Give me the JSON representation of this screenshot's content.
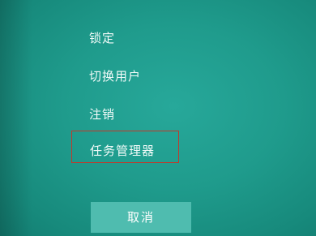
{
  "menu": {
    "items": [
      {
        "label": "锁定"
      },
      {
        "label": "切换用户"
      },
      {
        "label": "注销"
      },
      {
        "label": "任务管理器"
      }
    ],
    "highlighted_item": "任务管理器"
  },
  "cancel_button": {
    "label": "取消"
  },
  "colors": {
    "background": "#1f9b8c",
    "button": "#4fbcaf",
    "highlight_border": "#c0392b",
    "text": "#ffffff"
  }
}
